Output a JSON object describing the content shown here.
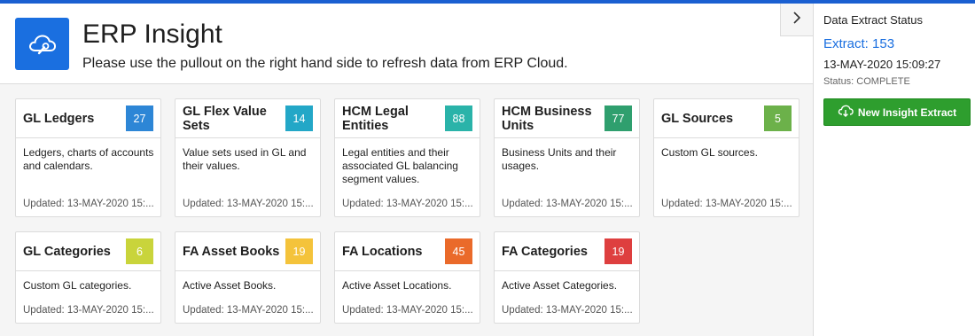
{
  "header": {
    "title": "ERP Insight",
    "subtitle": "Please use the pullout on the right hand side to refresh data from ERP Cloud."
  },
  "colors": {
    "brand_blue": "#1a6fe0",
    "topbar": "#1a5fd1",
    "button_green": "#2e9e2e"
  },
  "cards": [
    {
      "title": "GL Ledgers",
      "count": "27",
      "color": "#2d86d6",
      "description": "Ledgers, charts of accounts and calendars.",
      "updated": "Updated: 13-MAY-2020 15:..."
    },
    {
      "title": "GL Flex Value Sets",
      "count": "14",
      "color": "#23a7c7",
      "description": "Value sets used in GL and their values.",
      "updated": "Updated: 13-MAY-2020 15:..."
    },
    {
      "title": "HCM Legal Entities",
      "count": "88",
      "color": "#2ab3a9",
      "description": "Legal entities and their associated GL balancing segment values.",
      "updated": "Updated: 13-MAY-2020 15:..."
    },
    {
      "title": "HCM Business Units",
      "count": "77",
      "color": "#2f9f6e",
      "description": "Business Units and their usages.",
      "updated": "Updated: 13-MAY-2020 15:..."
    },
    {
      "title": "GL Sources",
      "count": "5",
      "color": "#6cb14a",
      "description": "Custom GL sources.",
      "updated": "Updated: 13-MAY-2020 15:..."
    },
    {
      "title": "GL Categories",
      "count": "6",
      "color": "#c9d43b",
      "description": "Custom GL categories.",
      "updated": "Updated: 13-MAY-2020 15:..."
    },
    {
      "title": "FA Asset Books",
      "count": "19",
      "color": "#f4c33b",
      "description": "Active Asset Books.",
      "updated": "Updated: 13-MAY-2020 15:..."
    },
    {
      "title": "FA Locations",
      "count": "45",
      "color": "#ea6a2a",
      "description": "Active Asset Locations.",
      "updated": "Updated: 13-MAY-2020 15:..."
    },
    {
      "title": "FA Categories",
      "count": "19",
      "color": "#de3f3f",
      "description": "Active Asset Categories.",
      "updated": "Updated: 13-MAY-2020 15:..."
    }
  ],
  "side_panel": {
    "heading": "Data Extract Status",
    "extract": "Extract: 153",
    "date": "13-MAY-2020 15:09:27",
    "status": "Status: COMPLETE",
    "button_label": "New Insight Extract"
  }
}
